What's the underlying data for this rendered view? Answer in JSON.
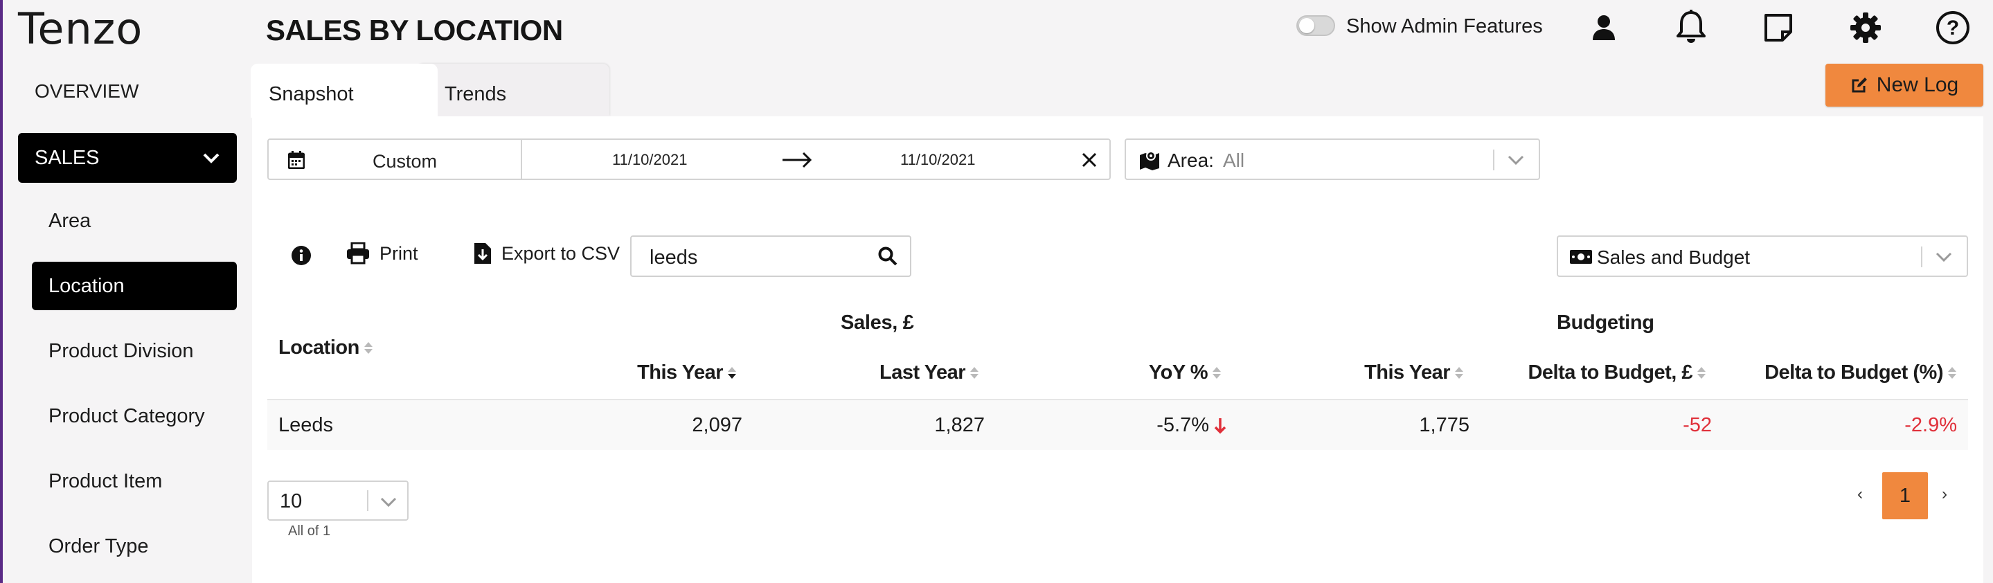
{
  "brand": {
    "logo_text": "Tenzo"
  },
  "header": {
    "title": "SALES BY LOCATION",
    "admin_toggle_label": "Show Admin Features",
    "admin_toggle_on": false
  },
  "sidebar": {
    "overview": "OVERVIEW",
    "sales": "SALES",
    "items": [
      {
        "label": "Area",
        "active": false
      },
      {
        "label": "Location",
        "active": true
      },
      {
        "label": "Product Division",
        "active": false
      },
      {
        "label": "Product Category",
        "active": false
      },
      {
        "label": "Product Item",
        "active": false
      },
      {
        "label": "Order Type",
        "active": false
      }
    ]
  },
  "tabs": [
    {
      "label": "Snapshot",
      "active": true
    },
    {
      "label": "Trends",
      "active": false
    }
  ],
  "new_log_label": "New Log",
  "filters": {
    "range_label": "Custom",
    "date_from": "11/10/2021",
    "date_to": "11/10/2021",
    "area_label": "Area:",
    "area_value": "All"
  },
  "toolbar": {
    "print_label": "Print",
    "export_label": "Export to CSV",
    "search_value": "leeds",
    "view_select": "Sales and Budget"
  },
  "table": {
    "group_sales": "Sales, £",
    "group_budget": "Budgeting",
    "col_location": "Location",
    "col_this_year": "This Year",
    "col_last_year": "Last Year",
    "col_yoy": "YoY %",
    "col_budget_this_year": "This Year",
    "col_delta": "Delta to Budget, £",
    "col_delta_pct": "Delta to Budget (%)",
    "rows": [
      {
        "location": "Leeds",
        "this_year": "2,097",
        "last_year": "1,827",
        "yoy": "-5.7%",
        "budget_this_year": "1,775",
        "delta": "-52",
        "delta_pct": "-2.9%"
      }
    ]
  },
  "pagination": {
    "page_size": "10",
    "all_of": "All of 1",
    "current": "1",
    "prev": "‹",
    "next": "›"
  },
  "colors": {
    "accent": "#f0883e",
    "negative": "#e0303a",
    "sidebar_active": "#000000"
  }
}
